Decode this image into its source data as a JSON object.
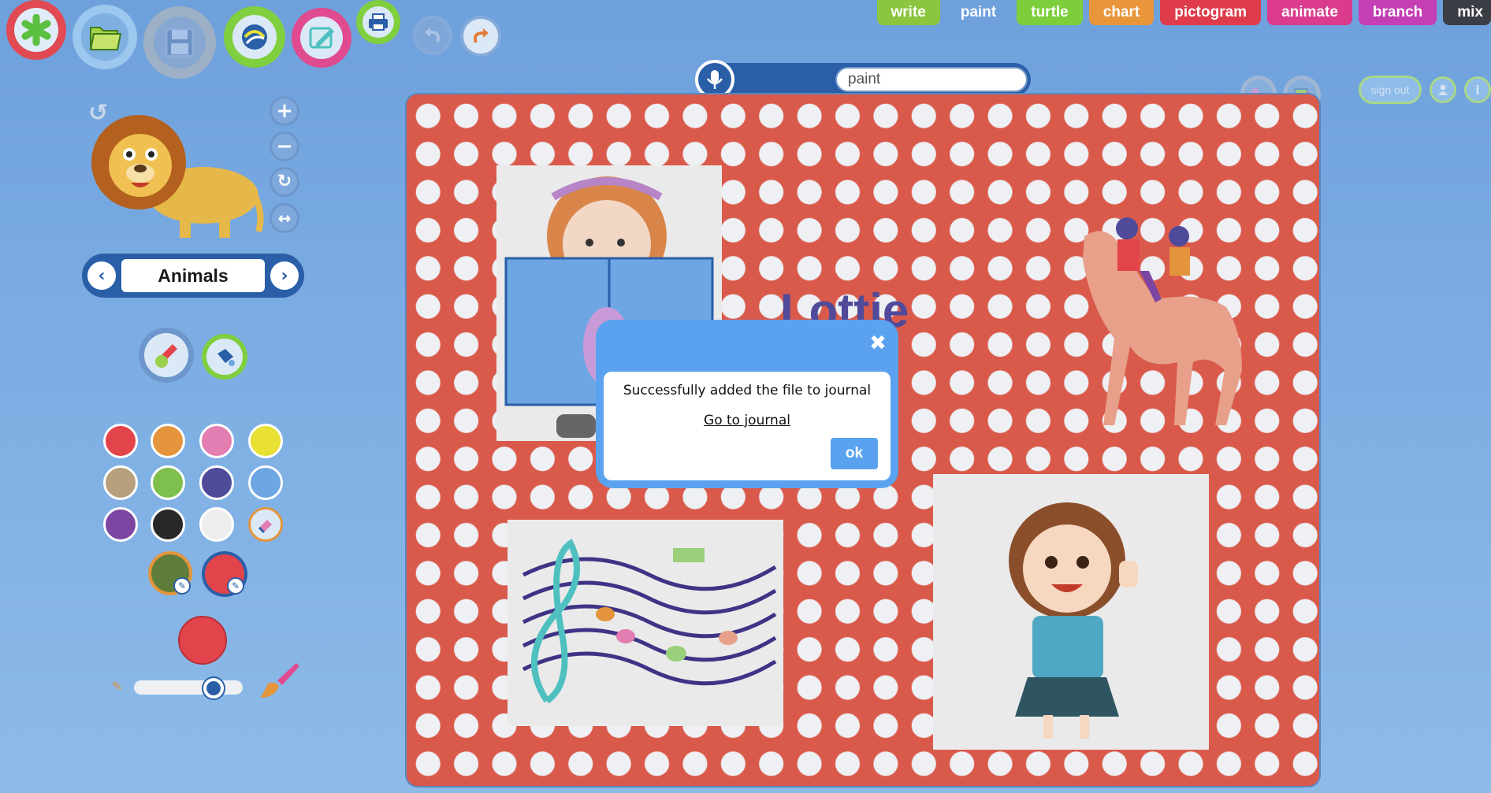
{
  "app": {
    "tabs": [
      {
        "label": "write",
        "color": "#8cc63e"
      },
      {
        "label": "paint",
        "color": "#6ea0dc"
      },
      {
        "label": "turtle",
        "color": "#7ccf3a"
      },
      {
        "label": "chart",
        "color": "#e9963a"
      },
      {
        "label": "pictogram",
        "color": "#df3b4a"
      },
      {
        "label": "animate",
        "color": "#da3b8c"
      },
      {
        "label": "branch",
        "color": "#c43fb3"
      },
      {
        "label": "mix",
        "color": "#3a3d44"
      }
    ],
    "toolbar": {
      "new_icon": "asterisk-icon",
      "open_icon": "folder-icon",
      "save_icon": "floppy-disk-icon",
      "network_icon": "globe-icon",
      "edit_icon": "edit-note-icon",
      "print_icon": "printer-icon",
      "undo_icon": "undo-arrow-icon",
      "redo_icon": "redo-arrow-icon"
    }
  },
  "search": {
    "value": "paint",
    "mic_icon": "microphone-icon"
  },
  "user": {
    "sign_out_label": "sign out"
  },
  "left_panel": {
    "category": {
      "label": "Animals"
    },
    "palette": {
      "colors": [
        "#e3434a",
        "#e4953c",
        "#e27eb2",
        "#e8e033",
        "#b89f7c",
        "#7fbf4d",
        "#4f4a9a",
        "#6ea6e3",
        "#7d45a2",
        "#282828",
        "#ededed"
      ],
      "selected_color": "#e3434a"
    }
  },
  "canvas": {
    "background_color": "#d95a4b",
    "dot_color": "#eef0f4",
    "text_stamp": "Lottie"
  },
  "dialog": {
    "message": "Successfully added the file to journal",
    "link": "Go to journal",
    "ok_label": "ok",
    "close_glyph": "✖"
  }
}
